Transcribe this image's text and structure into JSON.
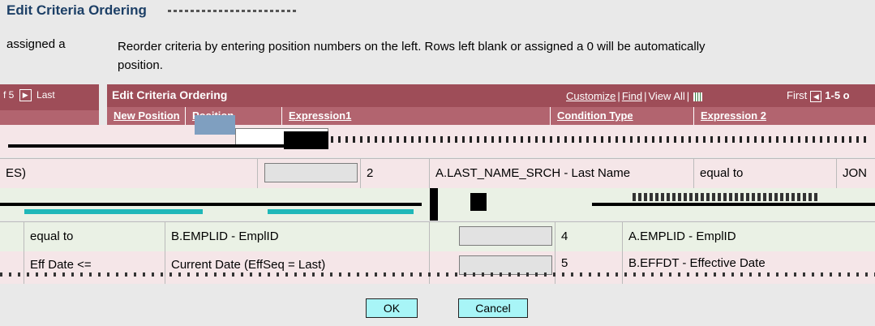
{
  "page": {
    "title": "Edit Criteria Ordering",
    "instructions_left": "assigned a",
    "instructions_line1": "Reorder criteria by entering position numbers on the left. Rows left blank or assigned a 0 will be automatically",
    "instructions_line2": "position."
  },
  "left_grid": {
    "range_suffix": "f 5",
    "last_label": "Last"
  },
  "grid": {
    "title": "Edit Criteria Ordering",
    "toolbar": {
      "customize": "Customize",
      "find": "Find",
      "view_all": "View All",
      "first": "First",
      "range": "1-5 o"
    },
    "columns": [
      "New Position",
      "Position",
      "Expression1",
      "Condition Type",
      "Expression 2"
    ]
  },
  "rows": [
    {
      "prefix": "ES)",
      "position": "2",
      "expression1": "A.LAST_NAME_SRCH - Last Name",
      "condition": "equal to",
      "expression2": "JON"
    },
    {
      "prefix": "equal to",
      "text2": "B.EMPLID - EmplID",
      "position": "4",
      "expression1": "A.EMPLID - EmplID"
    },
    {
      "prefix": "Eff Date <=",
      "text2": "Current Date (EffSeq = Last)",
      "position": "5",
      "expression1": "B.EFFDT - Effective Date"
    }
  ],
  "buttons": {
    "ok": "OK",
    "cancel": "Cancel"
  },
  "colors": {
    "header": "#9e4d58",
    "subheader": "#b2646f",
    "row_pink": "#f5e6e8",
    "row_green": "#eaf1e5",
    "button": "#a8f5f7"
  }
}
